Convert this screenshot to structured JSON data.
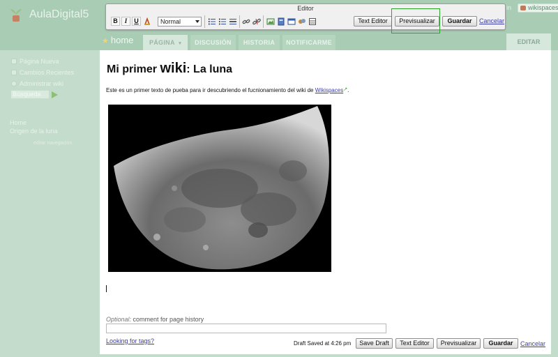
{
  "site": {
    "title": "AulaDigital5",
    "wikispaces_badge": "wikispaces",
    "join_fragment": "in"
  },
  "editor": {
    "title": "Editor",
    "bold_label": "B",
    "italic_label": "I",
    "underline_label": "U",
    "format_value": "Normal",
    "text_editor_label": "Text Editor",
    "preview_label": "Previsualizar",
    "save_label": "Guardar",
    "cancel_label": "Cancelar"
  },
  "tabs": {
    "home": "home",
    "pagina": "PÁGINA",
    "discusion": "DISCUSIÓN",
    "historia": "HISTORIA",
    "notificarme": "NOTIFICARME",
    "editar": "EDITAR"
  },
  "sidebar": {
    "items": [
      "Página Nueva",
      "Cambios Recientes",
      "Administrar wiki"
    ],
    "search_placeholder": "Búsqueda",
    "nav_links": [
      "Home",
      "Origen de la luna"
    ],
    "edit_nav": "editar navegación"
  },
  "content": {
    "heading_pre": "Mi primer ",
    "heading_big": "wiki",
    "heading_post": ": La luna",
    "intro_text": "Este es un primer texto de pueba para ir descubriendo el fucnionamiento del wiki de ",
    "intro_link": "Wikispaces",
    "intro_end": ".",
    "optional_label": "Optional:",
    "comment_label": " comment for page history",
    "tags_link": "Looking for tags?",
    "draft_status": "Draft Saved at 4:26 pm",
    "save_draft_label": "Save Draft",
    "text_editor_label": "Text Editor",
    "preview_label": "Previsualizar",
    "save_label": "Guardar",
    "cancel_label": "Cancelar"
  }
}
